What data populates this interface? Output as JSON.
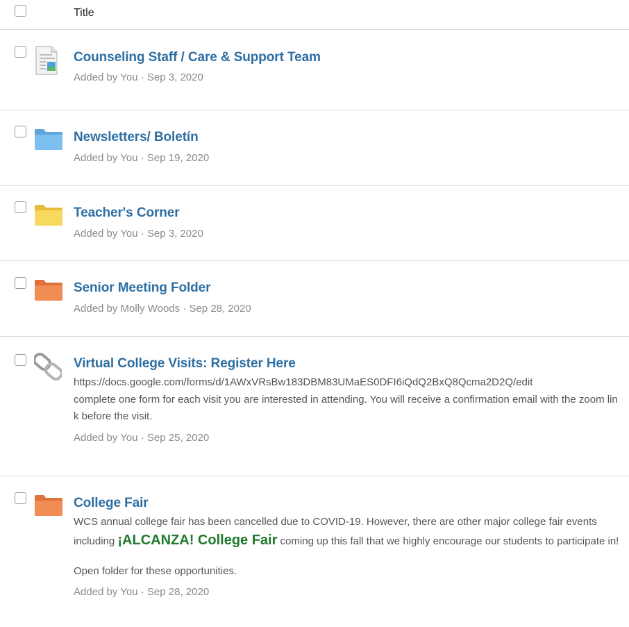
{
  "header": {
    "title": "Title"
  },
  "items": [
    {
      "title": "Counseling Staff / Care & Support Team",
      "meta": "Added by You · Sep 3, 2020",
      "icon": "document-icon"
    },
    {
      "title": "Newsletters/ Boletín",
      "meta": "Added by You · Sep 19, 2020",
      "icon": "folder-icon",
      "color": "#72b6e6"
    },
    {
      "title": "Teacher's Corner",
      "meta": "Added by You · Sep 3, 2020",
      "icon": "folder-icon",
      "color": "#f3d154"
    },
    {
      "title": "Senior Meeting Folder",
      "meta": "Added by Molly Woods · Sep 28, 2020",
      "icon": "folder-icon",
      "color": "#f08a52"
    },
    {
      "title": "Virtual College Visits: Register Here",
      "url": "https://docs.google.com/forms/d/1AWxVRsBw183DBM83UMaES0DFI6iQdQ2BxQ8Qcma2D2Q/edit",
      "description": "complete one form for each visit you are interested in attending. You will receive a confirmation email with the zoom link before the visit.",
      "meta": "Added by You · Sep 25, 2020",
      "icon": "link-icon"
    },
    {
      "title": "College Fair",
      "desc_before": "WCS annual college fair has been cancelled due to COVID-19.  However, there are other major college fair events including ",
      "desc_highlight": "¡ALCANZA! College Fair",
      "desc_after": " coming up this fall that we highly encourage our students to participate in!",
      "desc2": "Open folder for these opportunities.",
      "meta": "Added by You · Sep 28, 2020",
      "icon": "folder-icon",
      "color": "#f08a52"
    }
  ]
}
